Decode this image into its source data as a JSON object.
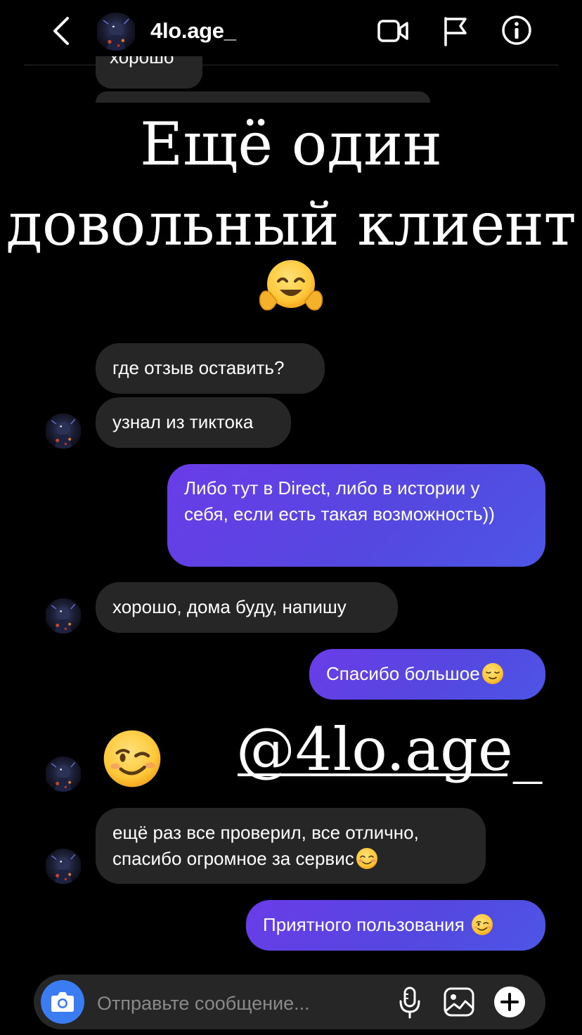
{
  "header": {
    "username": "4lo.age_",
    "icons": [
      "back-icon",
      "video-call-icon",
      "flag-icon",
      "info-icon"
    ]
  },
  "partial_message": "хорошо",
  "overlay": {
    "line1": "Ещё один",
    "line2": "довольный клиент",
    "emoji": "hugging-face"
  },
  "messages": [
    {
      "side": "in",
      "text": "где отзыв оставить?"
    },
    {
      "side": "in",
      "text": "узнал из тиктока"
    },
    {
      "side": "out",
      "text": "Либо тут в Direct, либо в истории у себя, если есть такая возможность))"
    },
    {
      "side": "in",
      "text": "хорошо, дома буду, напишу"
    },
    {
      "side": "out",
      "text": "Спасибо большое",
      "emoji": "relieved-face"
    },
    {
      "side": "in",
      "emoji": "winking-face"
    },
    {
      "side": "in",
      "text_line1": "ещё раз все проверил, все отлично,",
      "text_line2": "спасибо огромное за сервис",
      "emoji": "smiling-face"
    },
    {
      "side": "out",
      "text": "Приятного пользования ",
      "emoji": "winking-face"
    }
  ],
  "sticker_handle": "@4lo.age_",
  "composer": {
    "placeholder": "Отправьте сообщение...",
    "icons": [
      "camera-icon",
      "microphone-icon",
      "gallery-icon",
      "plus-icon"
    ]
  },
  "colors": {
    "background": "#000000",
    "incoming_bubble": "#262626",
    "outgoing_bubble": "#5a45e6",
    "camera_button": "#3b7cf2"
  }
}
